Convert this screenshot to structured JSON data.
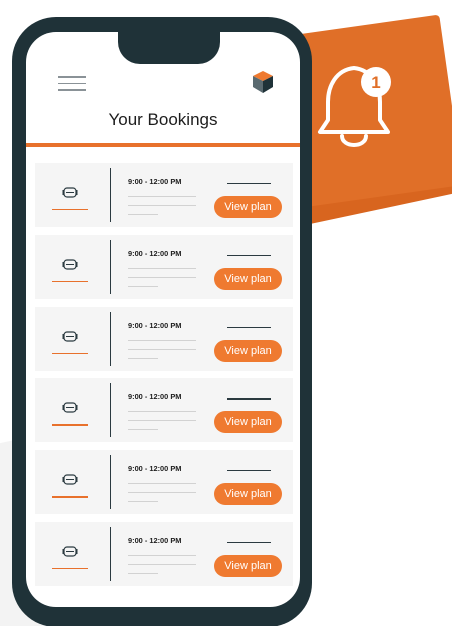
{
  "header": {
    "title": "Your Bookings",
    "menu_icon": "hamburger-menu-icon",
    "logo_icon": "cube-logo-icon"
  },
  "notification": {
    "icon": "bell-icon",
    "badge_count": "1"
  },
  "bookings": [
    {
      "time": "9:00 - 12:00 PM",
      "action": "View plan",
      "icon": "car-icon"
    },
    {
      "time": "9:00 - 12:00 PM",
      "action": "View plan",
      "icon": "car-icon"
    },
    {
      "time": "9:00 - 12:00 PM",
      "action": "View plan",
      "icon": "car-icon"
    },
    {
      "time": "9:00 - 12:00 PM",
      "action": "View plan",
      "icon": "car-icon"
    },
    {
      "time": "9:00 - 12:00 PM",
      "action": "View plan",
      "icon": "car-icon"
    },
    {
      "time": "9:00 - 12:00 PM",
      "action": "View plan",
      "icon": "car-icon"
    }
  ],
  "colors": {
    "accent": "#ef7a30",
    "phone_frame": "#1f3238",
    "card_background": "#f5f5f5"
  }
}
